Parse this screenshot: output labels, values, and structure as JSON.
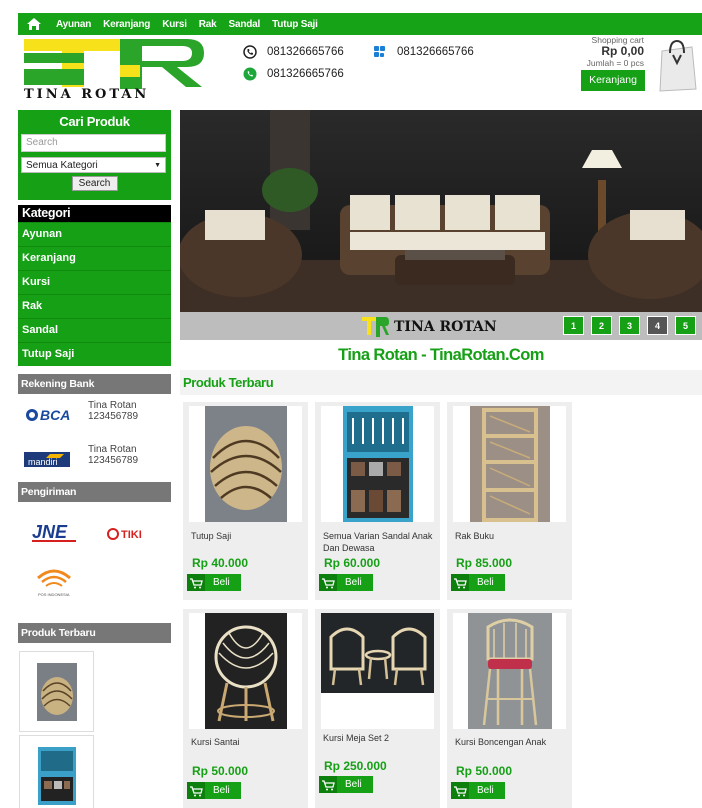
{
  "nav": {
    "items": [
      "Ayunan",
      "Keranjang",
      "Kursi",
      "Rak",
      "Sandal",
      "Tutup Saji"
    ]
  },
  "header": {
    "logo_text": "TINA ROTAN",
    "phone_1": "081326665766",
    "phone_2": "081326665766",
    "whatsapp": "081326665766"
  },
  "cart": {
    "title": "Shopping cart",
    "total": "Rp 0,00",
    "count": "Jumlah = 0 pcs",
    "button": "Keranjang"
  },
  "search": {
    "title": "Cari Produk",
    "placeholder": "Search",
    "category_selected": "Semua Kategori",
    "button": "Search"
  },
  "categories": {
    "title": "Kategori",
    "items": [
      "Ayunan",
      "Keranjang",
      "Kursi",
      "Rak",
      "Sandal",
      "Tutup Saji"
    ]
  },
  "bank": {
    "title": "Rekening Bank",
    "accounts": [
      {
        "bank": "BCA",
        "name": "Tina Rotan",
        "number": "123456789"
      },
      {
        "bank": "mandiri",
        "name": "Tina Rotan",
        "number": "123456789"
      }
    ]
  },
  "shipping": {
    "title": "Pengiriman",
    "carriers": [
      "JNE",
      "TIKI",
      "POS INDONESIA"
    ]
  },
  "sidebar_products": {
    "title": "Produk Terbaru"
  },
  "hero": {
    "brand": "TINA ROTAN",
    "slides": [
      "1",
      "2",
      "3",
      "4",
      "5"
    ]
  },
  "main": {
    "site_title": "Tina Rotan - TinaRotan.Com",
    "section_title": "Produk Terbaru",
    "buy_label": "Beli",
    "products": [
      {
        "name": "Tutup Saji",
        "price": "Rp 40.000"
      },
      {
        "name": "Semua Varian Sandal Anak Dan Dewasa",
        "price": "Rp 60.000"
      },
      {
        "name": "Rak Buku",
        "price": "Rp 85.000"
      },
      {
        "name": "Kursi Santai",
        "price": "Rp 50.000"
      },
      {
        "name": "Kursi Meja Set 2",
        "price": "Rp 250.000"
      },
      {
        "name": "Kursi Boncengan Anak",
        "price": "Rp 50.000"
      }
    ]
  },
  "colors": {
    "brand_green": "#16a016",
    "logo_yellow": "#f6e11b",
    "logo_green": "#2aa52a"
  }
}
